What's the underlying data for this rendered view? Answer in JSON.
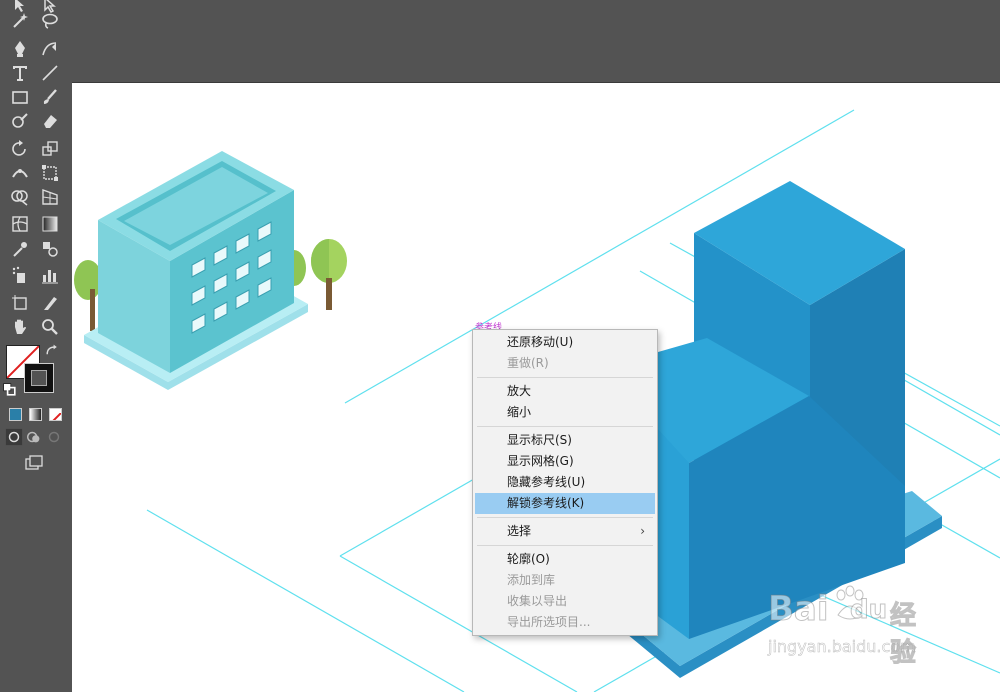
{
  "context_menu": {
    "items": [
      {
        "label": "还原移动(U)",
        "enabled": true
      },
      {
        "label": "重做(R)",
        "enabled": false
      },
      {
        "label": "放大",
        "enabled": true
      },
      {
        "label": "缩小",
        "enabled": true
      },
      {
        "label": "显示标尺(S)",
        "enabled": true
      },
      {
        "label": "显示网格(G)",
        "enabled": true
      },
      {
        "label": "隐藏参考线(U)",
        "enabled": true
      },
      {
        "label": "解锁参考线(K)",
        "enabled": true,
        "highlighted": true
      },
      {
        "label": "选择",
        "enabled": true,
        "submenu": true
      },
      {
        "label": "轮廓(O)",
        "enabled": true
      },
      {
        "label": "添加到库",
        "enabled": false
      },
      {
        "label": "收集以导出",
        "enabled": false
      },
      {
        "label": "导出所选项目...",
        "enabled": false
      }
    ]
  },
  "guide_label": "参考线",
  "watermark": {
    "brand": "Bai",
    "brand2": "du",
    "cn": "经验",
    "url": "jingyan.baidu.com"
  },
  "colors": {
    "canvas_bg": "#535353",
    "artboard": "#ffffff",
    "guide": "#5fe0ee",
    "highlight": "#99ccf2",
    "building_top": "#2ea6d9",
    "building_side": "#2387bf"
  }
}
